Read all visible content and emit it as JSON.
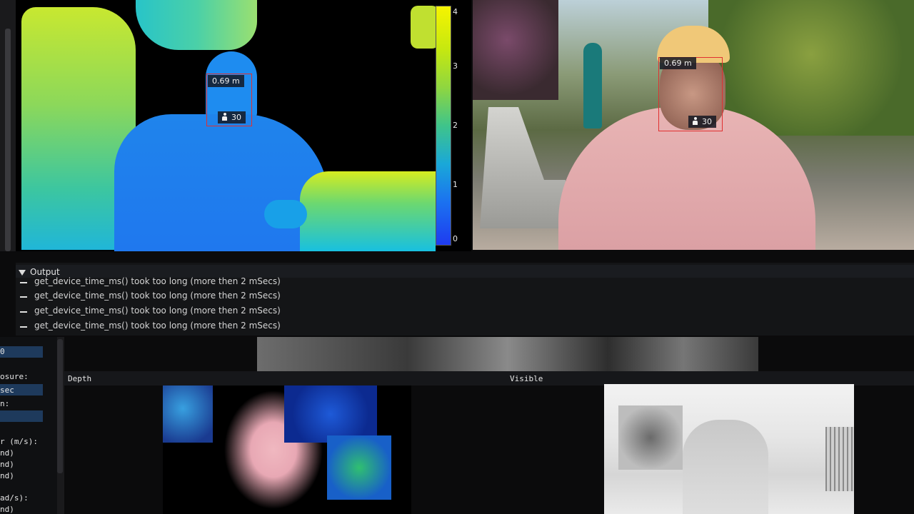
{
  "depth_view": {
    "colorbar_ticks": [
      "4",
      "3",
      "2",
      "1",
      "0"
    ],
    "detection": {
      "distance": "0.69 m",
      "confidence": "30",
      "label_icon": "person-icon"
    }
  },
  "rgb_view": {
    "detection": {
      "distance": "0.69 m",
      "confidence": "30",
      "label_icon": "person-icon"
    }
  },
  "output": {
    "title": "Output",
    "messages": [
      "get_device_time_ms() took too long (more then 2 mSecs)",
      "get_device_time_ms() took too long (more then 2 mSecs)",
      "get_device_time_ms() took too long (more then 2 mSecs)",
      "get_device_time_ms() took too long (more then 2 mSecs)"
    ]
  },
  "settings_panel": {
    "field1_value": "0",
    "exposure_label": "osure:",
    "exposure_value": "sec",
    "gain_label": "n:",
    "accel_label": "r (m/s):",
    "accel_v1": "nd)",
    "accel_v2": "nd)",
    "accel_v3": "nd)",
    "gyro_label": "ad/s):",
    "gyro_v1": "nd)"
  },
  "streams": {
    "depth_label": "Depth",
    "visible_label": "Visible"
  },
  "colors": {
    "detection_box": "#e03030",
    "input_field": "#1e3a5c",
    "panel_bg": "#141517"
  }
}
